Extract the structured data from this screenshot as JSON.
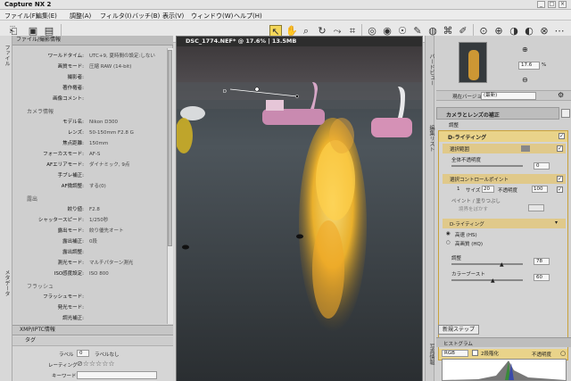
{
  "app": {
    "title": "Capture NX 2"
  },
  "window_controls": {
    "minimize": "_",
    "maximize": "□",
    "close": "×"
  },
  "menu": [
    "ファイル(F)",
    "編集(E)",
    "調整(A)",
    "フィルタ(I)",
    "バッチ(B)",
    "表示(V)",
    "ウィンドウ(W)",
    "ヘルプ(H)"
  ],
  "left": {
    "tab_label": "ファイル",
    "tab_label2": "メタデータ",
    "header": "ファイル/撮影情報",
    "rows": [
      {
        "k": "ワールドタイム:",
        "v": "UTC+9, 夏時間の設定:しない"
      },
      {
        "k": "画質モード:",
        "v": "圧縮 RAW (14-bit)"
      },
      {
        "k": "撮影者:",
        "v": ""
      },
      {
        "k": "著作権者:",
        "v": ""
      },
      {
        "k": "画像コメント:",
        "v": ""
      }
    ],
    "camera_section": "カメラ情報",
    "camera_rows": [
      {
        "k": "モデル名:",
        "v": "Nikon D300"
      },
      {
        "k": "レンズ:",
        "v": "50-150mm F2.8 G"
      },
      {
        "k": "焦点距離:",
        "v": "150mm"
      },
      {
        "k": "フォーカスモード:",
        "v": "AF-S"
      },
      {
        "k": "AFエリアモード:",
        "v": "ダイナミック, 9点"
      },
      {
        "k": "手ブレ補正:",
        "v": ""
      },
      {
        "k": "AF微調整:",
        "v": "する(0)"
      }
    ],
    "exposure_section": "露出",
    "exposure_rows": [
      {
        "k": "絞り値:",
        "v": "F2.8"
      },
      {
        "k": "シャッタースピード:",
        "v": "1/250秒"
      },
      {
        "k": "露出モード:",
        "v": "絞り優先オート"
      },
      {
        "k": "露出補正:",
        "v": "0段"
      },
      {
        "k": "露出調整:",
        "v": ""
      },
      {
        "k": "測光モード:",
        "v": "マルチパターン測光"
      },
      {
        "k": "ISO感度設定:",
        "v": "ISO 800"
      }
    ],
    "flash_section": "フラッシュ",
    "flash_rows": [
      {
        "k": "フラッシュモード:",
        "v": ""
      },
      {
        "k": "発光モード:",
        "v": ""
      },
      {
        "k": "調光補正:",
        "v": ""
      }
    ],
    "xmp_header": "XMP/IPTC情報",
    "tag_header": "タグ",
    "label_key": "ラベル",
    "label_value": "0",
    "label_text": "ラベルなし",
    "rating_key": "レーティング",
    "rating_stars": "⊘☆☆☆☆☆",
    "keyword_key": "キーワード"
  },
  "image": {
    "title": "DSC_1774.NEF* @ 17.6% | 13.5MB"
  },
  "right": {
    "nav_tab": "バードビュー",
    "zoom": "17.6",
    "zoom_unit": "%",
    "version_label": "現在バージョン",
    "version_value": "(最新)",
    "edit_tab": "編集リスト",
    "camera_lens": "カメラとレンズの補正",
    "adjust_label": "調整",
    "dlighting": "D-ライティング",
    "select_range": "選択範囲",
    "whole_opacity": "全体不透明度",
    "opacity_value": "0",
    "control_point": "選択コントロールポイント",
    "cp_num": "1",
    "cp_size": "サイズ",
    "cp_size_val": "20",
    "cp_opacity": "不透明度",
    "cp_opacity_val": "100",
    "paint": "ペイント / 塗りつぶし",
    "feather": "境界をぼかす",
    "dlighting_dd": "D-ライティング",
    "radio1": "高速 (HS)",
    "radio2": "高画質 (HQ)",
    "adjust2": "調整",
    "adjust_val": "78",
    "color_boost": "カラーブースト",
    "boost_val": "60",
    "opacity_footer": "不透明度",
    "new_step": "新規ステップ",
    "histogram": "ヒストグラム",
    "hist_channel": "RGB",
    "hist_check": "2段階化",
    "photo_info": "写真情報"
  }
}
